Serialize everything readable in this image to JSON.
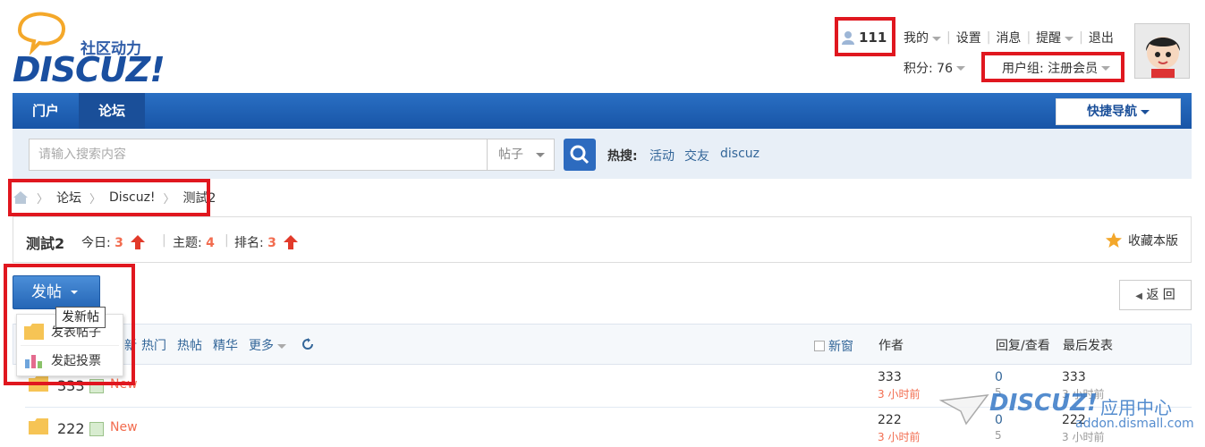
{
  "logo": {
    "slogan": "社区动力",
    "wordmark": "DISCUZ!"
  },
  "user": {
    "username": "111",
    "menu": [
      "我的",
      "设置",
      "消息",
      "提醒",
      "退出"
    ],
    "credit_label": "积分: 76",
    "group_label": "用户组: 注册会员"
  },
  "nav": {
    "tabs": [
      "门户",
      "论坛"
    ],
    "active_tab": "论坛",
    "quick_nav": "快捷导航"
  },
  "search": {
    "placeholder": "请输入搜索内容",
    "type": "帖子",
    "hot_label": "热搜:",
    "hot_keywords": [
      "活动",
      "交友",
      "discuz"
    ]
  },
  "breadcrumb": [
    "论坛",
    "Discuz!",
    "测試2"
  ],
  "forum": {
    "title": "测試2",
    "today_label": "今日:",
    "today_value": "3",
    "topics_label": "主题:",
    "topics_value": "4",
    "rank_label": "排名:",
    "rank_value": "3",
    "favorite": "收藏本版"
  },
  "actions": {
    "post_button": "发帖",
    "tooltip": "发新帖",
    "menu": [
      "发表帖子",
      "发起投票"
    ],
    "back": "返 回"
  },
  "list": {
    "filters": [
      "新",
      "热门",
      "热帖",
      "精华",
      "更多"
    ],
    "new_window": "新窗",
    "columns": {
      "author": "作者",
      "replies": "回复/查看",
      "last_post": "最后发表"
    },
    "threads": [
      {
        "subject": "333",
        "tag": "New",
        "author": "333",
        "author_time": "3 小时前",
        "replies": "0",
        "views": "5",
        "last_user": "333",
        "last_time": "3 小时前"
      },
      {
        "subject": "222",
        "tag": "New",
        "author": "222",
        "author_time": "3 小时前",
        "replies": "0",
        "views": "5",
        "last_user": "222",
        "last_time": "3 小时前"
      }
    ]
  },
  "watermark": {
    "word": "DISCUZ!",
    "cn": "应用中心",
    "url": "addon.dismall.com"
  },
  "colors": {
    "nav_blue": "#1855a7",
    "highlight_red": "#e0171f",
    "accent_orange": "#f26c4f",
    "link_blue": "#336699"
  }
}
